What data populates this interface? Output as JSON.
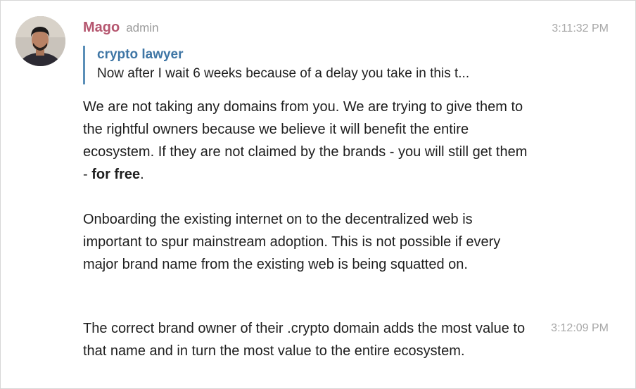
{
  "message": {
    "sender": {
      "name": "Mago",
      "role": "admin",
      "avatar_icon": "user-photo-avatar"
    },
    "time_first": "3:11:32 PM",
    "reply": {
      "author": "crypto lawyer",
      "text": "Now after I wait 6 weeks because of a delay you take in this t..."
    },
    "paragraphs": [
      {
        "text": "We are not taking any domains from you. We are trying to give them to the rightful owners because we believe it will benefit the entire ecosystem. If they are not claimed by the brands - you will still get them - ",
        "bold": "for free",
        "suffix": "."
      },
      {
        "text": "Onboarding the existing internet on to the decentralized web is important to spur mainstream adoption. This is not possible if every major brand name from the existing web is being squatted on."
      }
    ]
  },
  "followup": {
    "time": "3:12:09 PM",
    "text": "The correct brand owner of their .crypto domain adds the most value to that name and in turn the most value to the entire ecosystem."
  },
  "colors": {
    "sender": "#b5566f",
    "reply_bar": "#5b8fb8",
    "reply_author": "#3f76a5",
    "timestamp": "#a8a8a8"
  }
}
